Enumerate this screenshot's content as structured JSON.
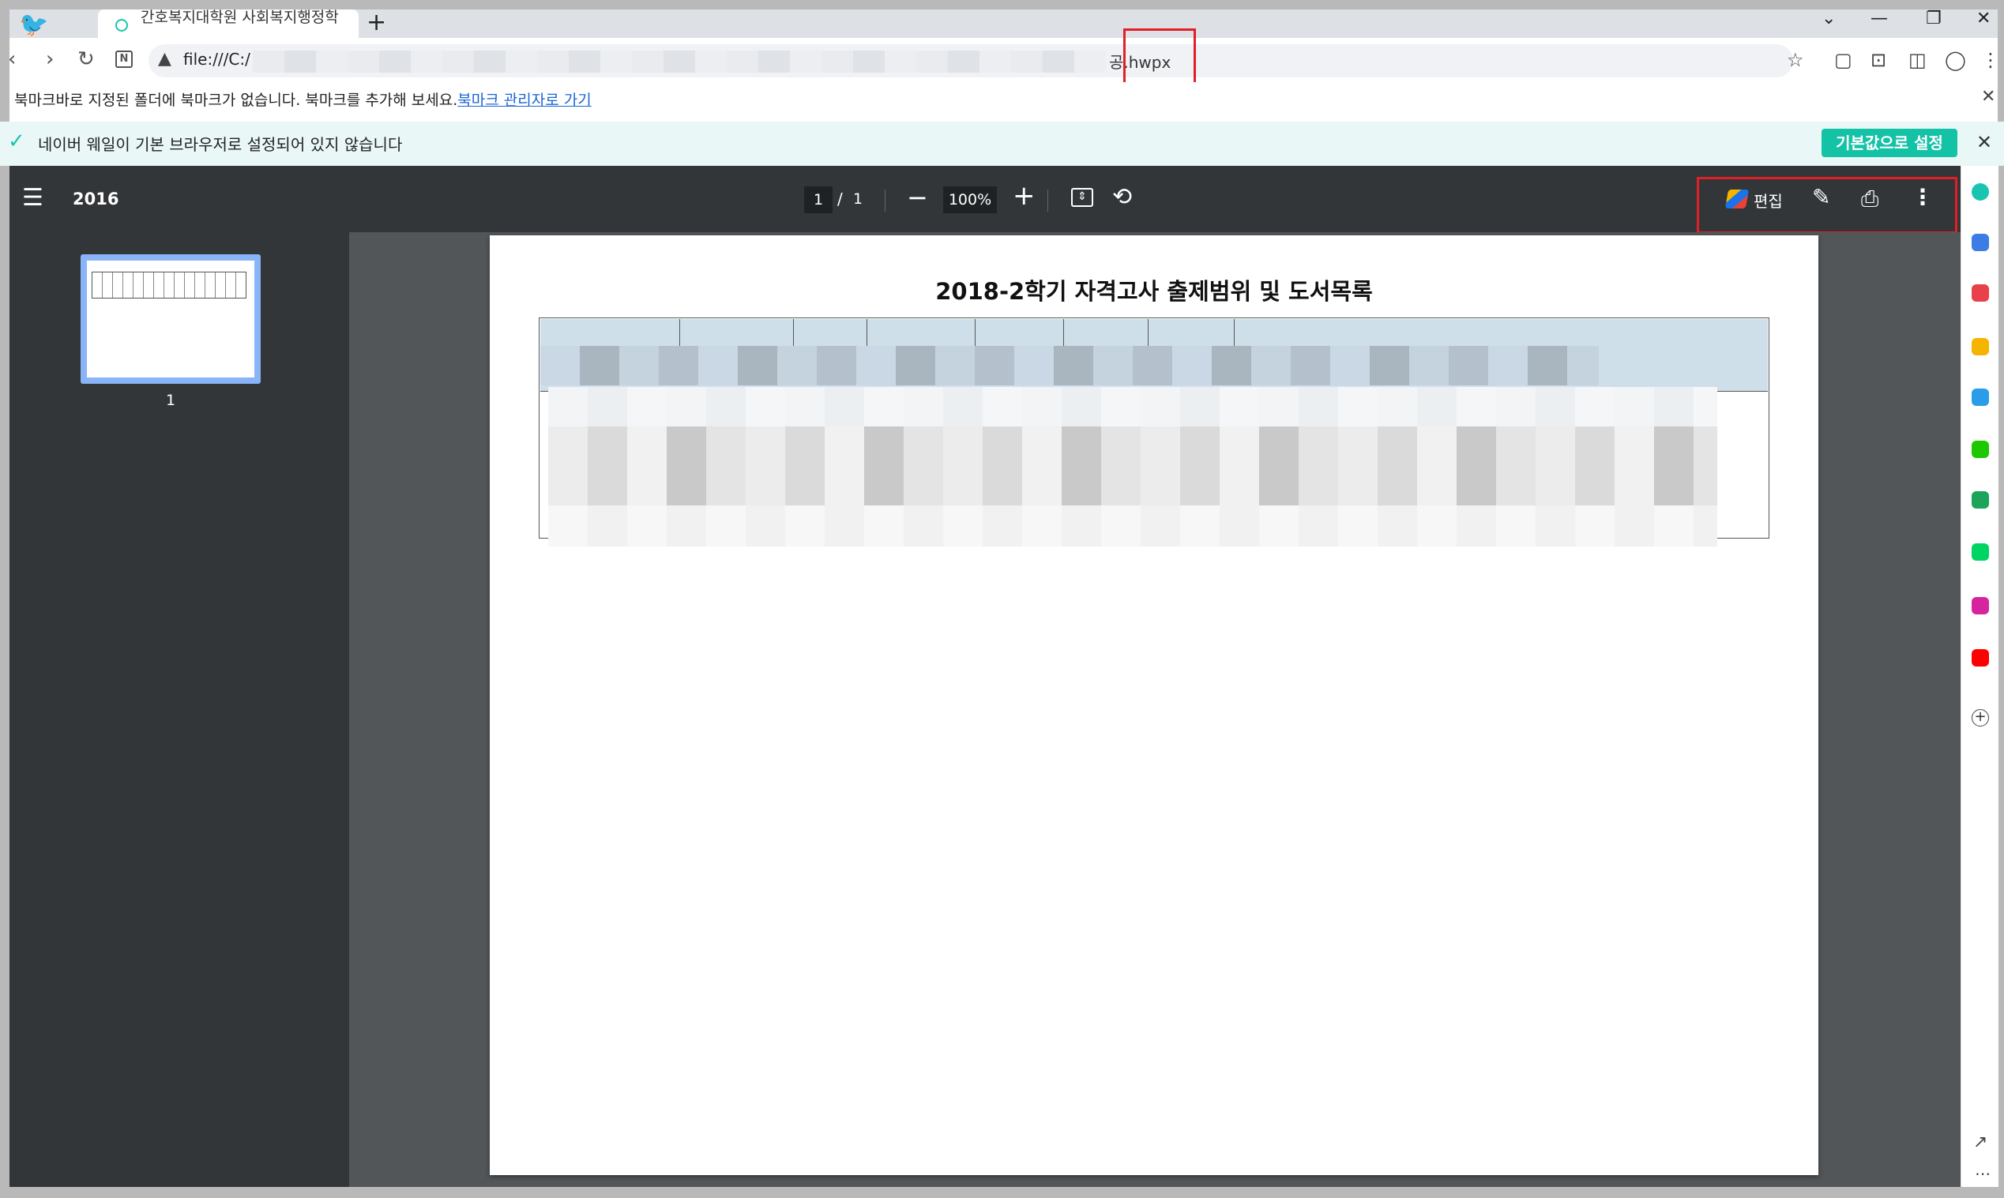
{
  "tab": {
    "title": "간호복지대학원 사회복지행정학",
    "new_tab": "+"
  },
  "window": {
    "chevron": "⌄",
    "minimize": "—",
    "restore": "❐",
    "close": "✕"
  },
  "nav": {
    "back": "‹",
    "forward": "›",
    "reload": "↻",
    "n_icon": "N"
  },
  "url": {
    "prefix": "file:///C:/",
    "suffix": "공.hwpx"
  },
  "toolbar_icons": {
    "favorite": "☆",
    "capture": "▢",
    "screenshot": "⊡",
    "split": "◫",
    "profile": "◯",
    "menu": "⋮"
  },
  "bookmark_bar": {
    "message": "북마크바로 지정된 폴더에 북마크가 없습니다. 북마크를 추가해 보세요.",
    "link": "북마크 관리자로 가기",
    "close": "✕"
  },
  "infobar": {
    "check": "✓",
    "message": "네이버 웨일이 기본 브라우저로 설정되어 있지 않습니다",
    "button": "기본값으로 설정",
    "close": "✕"
  },
  "pdf_toolbar": {
    "menu": "☰",
    "title": "2016",
    "page_current": "1",
    "page_sep": "/",
    "page_total": "1",
    "zoom_out": "−",
    "zoom": "100%",
    "zoom_in": "+",
    "fit": "⇕",
    "rotate": "⟲",
    "edit_label": "편집",
    "pencil": "✎",
    "print": "⎙",
    "more": "⋮"
  },
  "thumbnail": {
    "page_number": "1"
  },
  "document": {
    "title": "2018-2학기 자격고사 출제범위 및 도서목록"
  },
  "app_sidebar": {
    "icons": [
      {
        "name": "whale-icon",
        "color": "#19c5b2"
      },
      {
        "name": "calendar-icon",
        "color": "#3b7ce5"
      },
      {
        "name": "pocket-icon",
        "color": "#e9414b"
      },
      {
        "name": "star-icon",
        "color": "#f5b400"
      },
      {
        "name": "edge-icon",
        "color": "#2b9de8"
      },
      {
        "name": "naver-icon",
        "color": "#1ec800"
      },
      {
        "name": "stock-icon",
        "color": "#1ea35a"
      },
      {
        "name": "webtoon-icon",
        "color": "#00d564"
      },
      {
        "name": "instagram-icon",
        "color": "#d6249f"
      },
      {
        "name": "youtube-icon",
        "color": "#ff0000"
      }
    ],
    "add": "+",
    "external": "↗",
    "more": "⋯"
  }
}
